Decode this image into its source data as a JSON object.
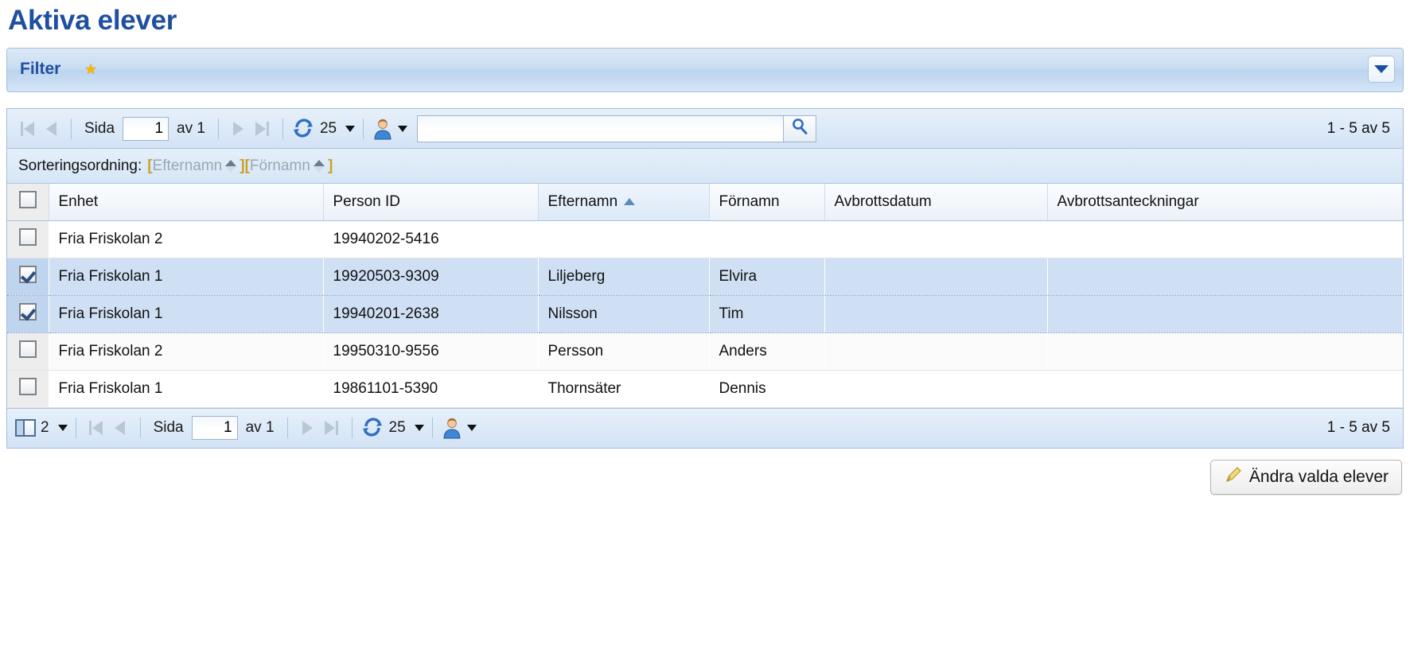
{
  "page": {
    "title": "Aktiva elever"
  },
  "filter": {
    "label": "Filter",
    "star_icon": "star-icon",
    "toggle_icon": "chevron-down-icon"
  },
  "toolbar_top": {
    "first_icon": "first-page-icon",
    "prev_icon": "prev-page-icon",
    "page_label": "Sida",
    "page_value": "1",
    "of_label": "av 1",
    "next_icon": "next-page-icon",
    "last_icon": "last-page-icon",
    "refresh_icon": "refresh-icon",
    "page_size": "25",
    "user_icon": "user-icon",
    "search_value": "",
    "search_placeholder": "",
    "search_icon": "search-icon",
    "count": "1 - 5 av 5"
  },
  "sortbar": {
    "label": "Sorteringsordning:",
    "tokens": [
      {
        "open": "[",
        "name": "Efternamn",
        "close": "]"
      },
      {
        "open": "[",
        "name": "Förnamn",
        "close": "]"
      }
    ]
  },
  "table": {
    "select_all_checked": false,
    "columns": [
      {
        "label": "Enhet",
        "sorted": false
      },
      {
        "label": "Person ID",
        "sorted": false
      },
      {
        "label": "Efternamn",
        "sorted": true,
        "sort_dir": "asc"
      },
      {
        "label": "Förnamn",
        "sorted": false
      },
      {
        "label": "Avbrottsdatum",
        "sorted": false
      },
      {
        "label": "Avbrottsanteckningar",
        "sorted": false
      }
    ],
    "rows": [
      {
        "selected": false,
        "enhet": "Fria Friskolan 2",
        "person_id": "19940202-5416",
        "efternamn": "",
        "fornamn": "",
        "avbrottsdatum": "",
        "avbrottsanteckningar": ""
      },
      {
        "selected": true,
        "enhet": "Fria Friskolan 1",
        "person_id": "19920503-9309",
        "efternamn": "Liljeberg",
        "fornamn": "Elvira",
        "avbrottsdatum": "",
        "avbrottsanteckningar": ""
      },
      {
        "selected": true,
        "enhet": "Fria Friskolan 1",
        "person_id": "19940201-2638",
        "efternamn": "Nilsson",
        "fornamn": "Tim",
        "avbrottsdatum": "",
        "avbrottsanteckningar": ""
      },
      {
        "selected": false,
        "enhet": "Fria Friskolan 2",
        "person_id": "19950310-9556",
        "efternamn": "Persson",
        "fornamn": "Anders",
        "avbrottsdatum": "",
        "avbrottsanteckningar": ""
      },
      {
        "selected": false,
        "enhet": "Fria Friskolan 1",
        "person_id": "19861101-5390",
        "efternamn": "Thornsäter",
        "fornamn": "Dennis",
        "avbrottsdatum": "",
        "avbrottsanteckningar": ""
      }
    ]
  },
  "toolbar_bottom": {
    "selection_icon": "selection-columns-icon",
    "selection_count": "2",
    "first_icon": "first-page-icon",
    "prev_icon": "prev-page-icon",
    "page_label": "Sida",
    "page_value": "1",
    "of_label": "av 1",
    "next_icon": "next-page-icon",
    "last_icon": "last-page-icon",
    "refresh_icon": "refresh-icon",
    "page_size": "25",
    "user_icon": "user-icon",
    "count": "1 - 5 av 5"
  },
  "footer": {
    "edit_button_label": "Ändra valda elever",
    "edit_button_icon": "pencil-icon"
  },
  "colors": {
    "accent_blue": "#1F4FA0",
    "panel_blue": "#C9DDF2",
    "selected_row": "#CFE0F4",
    "star_yellow": "#F2B705"
  }
}
